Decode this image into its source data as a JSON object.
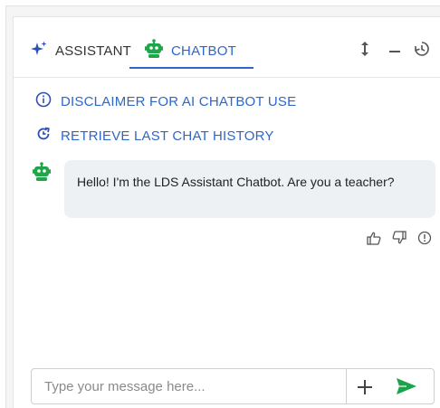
{
  "tabs": [
    {
      "label": "ASSISTANT",
      "icon": "sparkle-icon",
      "active": false
    },
    {
      "label": "CHATBOT",
      "icon": "robot-icon",
      "active": true
    }
  ],
  "toolbar": {
    "icons": [
      "resize-vertical-icon",
      "minimize-icon",
      "history-icon"
    ]
  },
  "links": {
    "disclaimer": "DISCLAIMER FOR AI CHATBOT USE",
    "retrieve": "RETRIEVE LAST CHAT HISTORY"
  },
  "messages": [
    {
      "sender": "bot",
      "text": "Hello! I'm the LDS Assistant Chatbot. Are you a teacher?"
    }
  ],
  "feedback": {
    "icons": [
      "thumbs-up-icon",
      "thumbs-down-icon",
      "report-icon"
    ]
  },
  "composer": {
    "placeholder": "Type your message here...",
    "value": ""
  },
  "colors": {
    "accent": "#2e67c8",
    "bot_green": "#1fa64a",
    "send_green": "#19a34a",
    "bubble_bg": "#eef1f4"
  }
}
